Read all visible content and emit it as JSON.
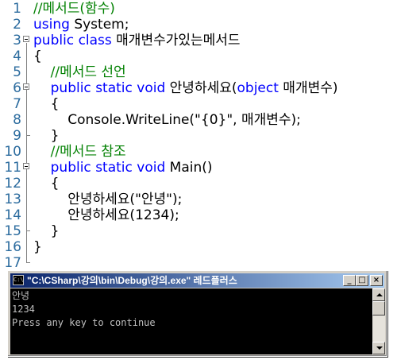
{
  "editor": {
    "line_numbers": [
      "1",
      "2",
      "3",
      "4",
      "5",
      "6",
      "7",
      "8",
      "9",
      "10",
      "11",
      "12",
      "13",
      "14",
      "15",
      "16",
      "17"
    ],
    "lines": [
      {
        "segments": [
          {
            "t": "//메서드(함수)",
            "c": "cm"
          }
        ]
      },
      {
        "segments": [
          {
            "t": "using",
            "c": "kw"
          },
          {
            "t": " System;",
            "c": ""
          }
        ]
      },
      {
        "segments": [
          {
            "t": "public",
            "c": "kw"
          },
          {
            "t": " ",
            "c": ""
          },
          {
            "t": "class",
            "c": "kw"
          },
          {
            "t": " 매개변수가있는메서드",
            "c": ""
          }
        ]
      },
      {
        "segments": [
          {
            "t": "{",
            "c": ""
          }
        ]
      },
      {
        "segments": [
          {
            "t": "    //메서드 선언",
            "c": "cm"
          }
        ]
      },
      {
        "segments": [
          {
            "t": "    ",
            "c": ""
          },
          {
            "t": "public",
            "c": "kw"
          },
          {
            "t": " ",
            "c": ""
          },
          {
            "t": "static",
            "c": "kw"
          },
          {
            "t": " ",
            "c": ""
          },
          {
            "t": "void",
            "c": "kw"
          },
          {
            "t": " 안녕하세요(",
            "c": ""
          },
          {
            "t": "object",
            "c": "kw"
          },
          {
            "t": " 매개변수)",
            "c": ""
          }
        ]
      },
      {
        "segments": [
          {
            "t": "    {",
            "c": ""
          }
        ]
      },
      {
        "segments": [
          {
            "t": "        Console.WriteLine(\"{0}\", 매개변수);",
            "c": ""
          }
        ]
      },
      {
        "segments": [
          {
            "t": "    }",
            "c": ""
          }
        ]
      },
      {
        "segments": [
          {
            "t": "    //메서드 참조",
            "c": "cm"
          }
        ]
      },
      {
        "segments": [
          {
            "t": "    ",
            "c": ""
          },
          {
            "t": "public",
            "c": "kw"
          },
          {
            "t": " ",
            "c": ""
          },
          {
            "t": "static",
            "c": "kw"
          },
          {
            "t": " ",
            "c": ""
          },
          {
            "t": "void",
            "c": "kw"
          },
          {
            "t": " Main()",
            "c": ""
          }
        ]
      },
      {
        "segments": [
          {
            "t": "    {",
            "c": ""
          }
        ]
      },
      {
        "segments": [
          {
            "t": "        안녕하세요(\"안녕\");",
            "c": ""
          }
        ]
      },
      {
        "segments": [
          {
            "t": "        안녕하세요(1234);",
            "c": ""
          }
        ]
      },
      {
        "segments": [
          {
            "t": "    }",
            "c": ""
          }
        ]
      },
      {
        "segments": [
          {
            "t": "}",
            "c": ""
          }
        ]
      },
      {
        "segments": [
          {
            "t": "",
            "c": ""
          }
        ]
      }
    ]
  },
  "console": {
    "icon_label": "C:\\",
    "title": "\"C:\\CSharp\\강의\\bin\\Debug\\강의.exe\" 레드플러스",
    "buttons": {
      "minimize": "_",
      "maximize": "□",
      "close": "×"
    },
    "output": [
      "안녕",
      "1234",
      "Press any key to continue"
    ]
  }
}
